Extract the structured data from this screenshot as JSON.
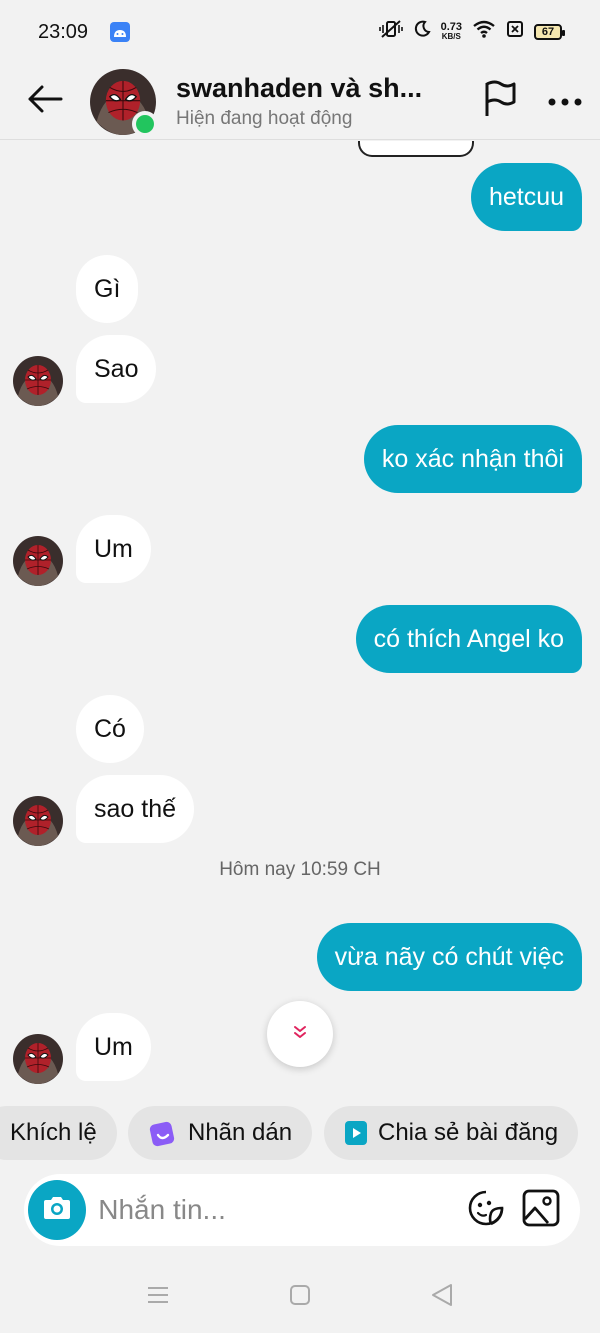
{
  "status_bar": {
    "time": "23:09",
    "net_speed_value": "0.73",
    "net_speed_unit": "KB/S",
    "battery": "67"
  },
  "header": {
    "title": "swanhaden và sh...",
    "subtitle": "Hiện đang hoạt động",
    "online_color": "#22c55e"
  },
  "messages": [
    {
      "direction": "out",
      "text": "hetcuu"
    },
    {
      "direction": "in",
      "text": "Gì"
    },
    {
      "direction": "in",
      "text": "Sao"
    },
    {
      "direction": "out",
      "text": "ko xác nhận thôi"
    },
    {
      "direction": "in",
      "text": "Um"
    },
    {
      "direction": "out",
      "text": "có thích Angel ko"
    },
    {
      "direction": "in",
      "text": "Có"
    },
    {
      "direction": "in",
      "text": "sao thế"
    },
    {
      "direction": "out",
      "text": "vừa nãy có chút việc"
    },
    {
      "direction": "in",
      "text": "Um"
    }
  ],
  "timestamp": "Hôm nay 10:59 CH",
  "quick_actions": [
    {
      "label": "Khích lệ"
    },
    {
      "label": "Nhãn dán"
    },
    {
      "label": "Chia sẻ bài đăng"
    }
  ],
  "composer": {
    "placeholder": "Nhắn tin..."
  },
  "colors": {
    "accent": "#0aa6c4",
    "background": "#f2f2f2",
    "incoming_bubble": "#ffffff"
  },
  "icons": {
    "back": "arrow-left-icon",
    "flag": "flag-icon",
    "more": "more-horizontal-icon",
    "camera": "camera-icon",
    "sticker": "sticker-icon",
    "gallery": "image-icon",
    "scroll": "double-chevron-down-icon"
  }
}
